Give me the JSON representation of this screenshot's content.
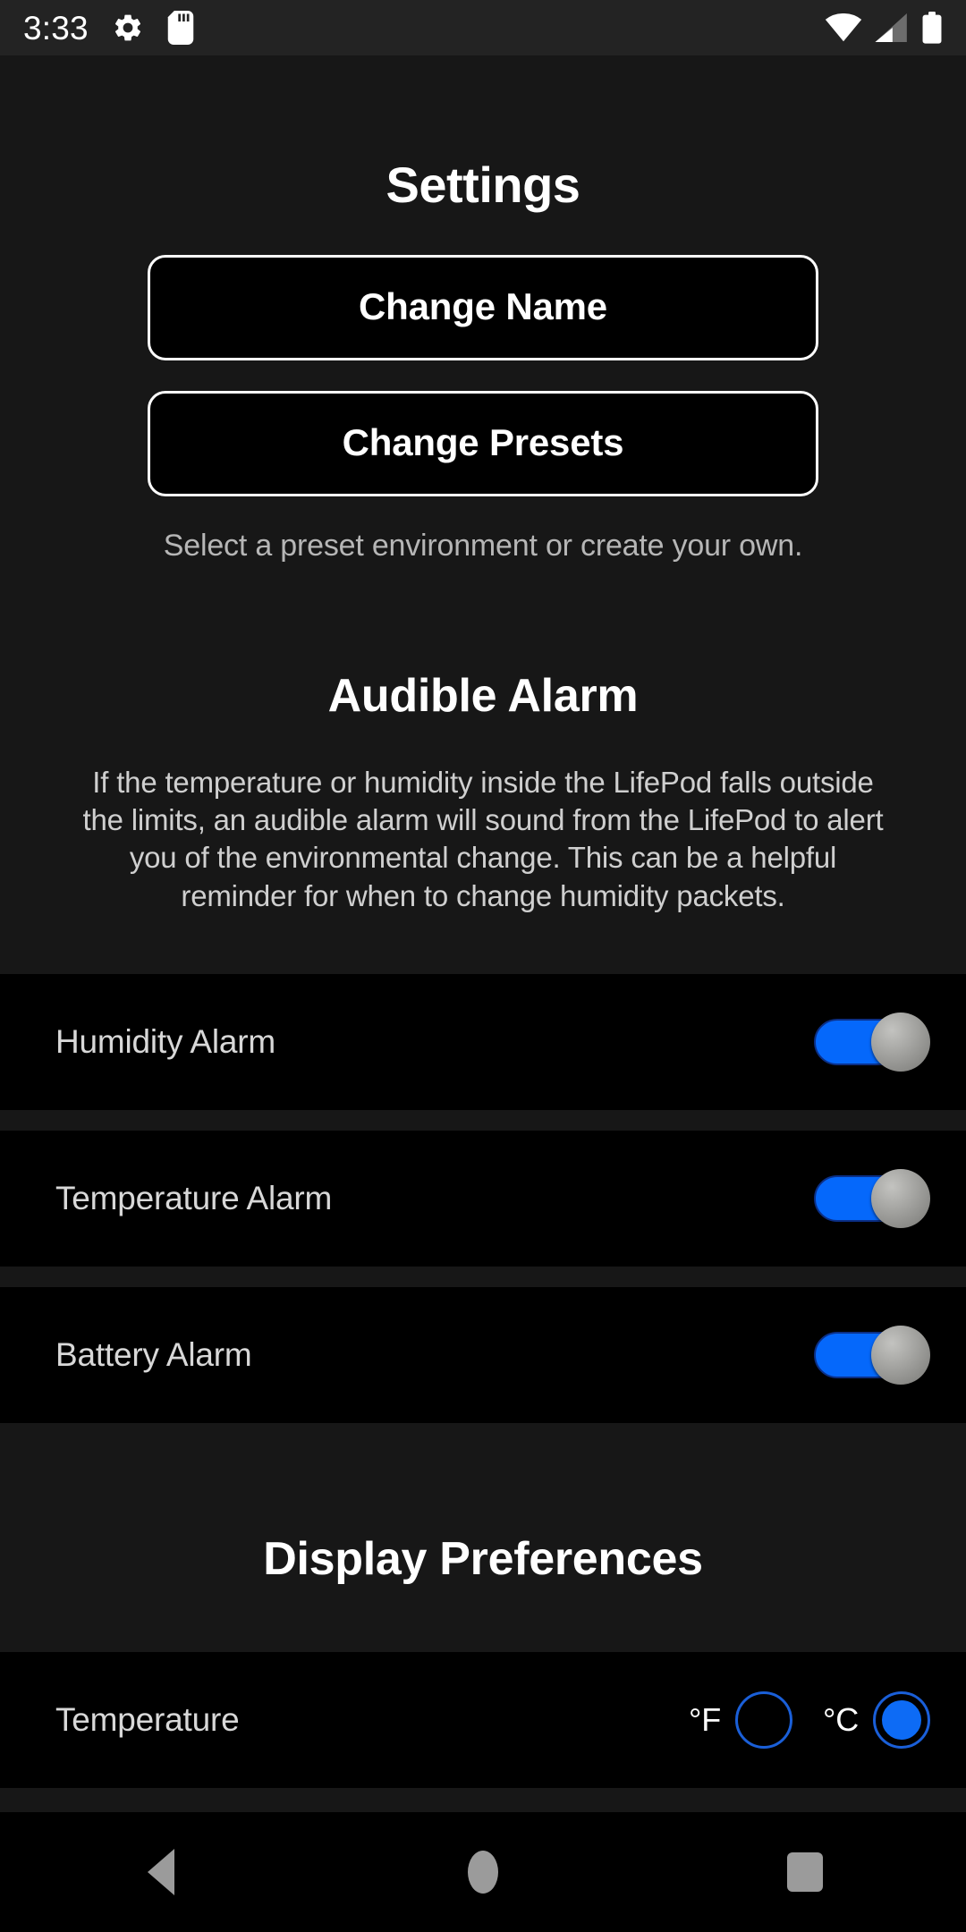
{
  "statusbar": {
    "time": "3:33",
    "icons_left": [
      "gear-icon",
      "sd-card-icon"
    ],
    "icons_right": [
      "wifi-icon",
      "cellular-signal-icon",
      "battery-icon"
    ]
  },
  "page": {
    "title": "Settings"
  },
  "actions": {
    "change_name": "Change Name",
    "change_presets": "Change Presets",
    "presets_helper": "Select a preset environment or create your own."
  },
  "audible_alarm": {
    "title": "Audible Alarm",
    "description": "If the temperature or humidity inside the LifePod falls outside the limits, an audible alarm will sound from the LifePod to alert you of the environmental change. This can be a helpful reminder for when to change humidity packets.",
    "rows": [
      {
        "label": "Humidity Alarm",
        "state": "on"
      },
      {
        "label": "Temperature Alarm",
        "state": "on"
      },
      {
        "label": "Battery Alarm",
        "state": "on"
      }
    ]
  },
  "display_preferences": {
    "title": "Display Preferences",
    "temperature": {
      "label": "Temperature",
      "options": [
        {
          "label": "°F",
          "selected": false
        },
        {
          "label": "°C",
          "selected": true
        }
      ]
    }
  },
  "navbar": {
    "back": "back-button",
    "home": "home-button",
    "recents": "recents-button"
  },
  "colors": {
    "accent_blue": "#0568fb",
    "radio_blue": "#0d6bf5",
    "background": "#171717",
    "row_background": "#000000",
    "thumb_grey": "#a9a9a6",
    "helper_text": "#b6b6b6"
  }
}
